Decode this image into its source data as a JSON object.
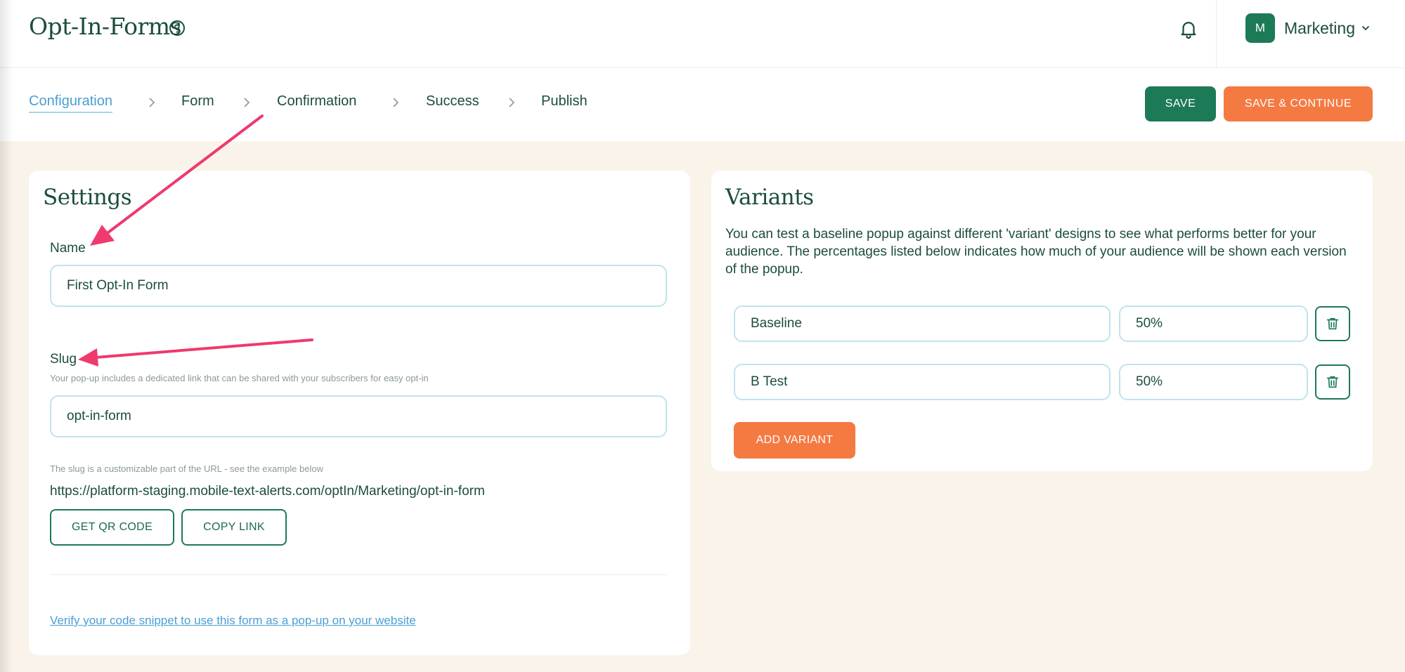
{
  "app": {
    "title": "Opt-In-Forms"
  },
  "header": {
    "account": {
      "initial": "M",
      "name": "Marketing"
    }
  },
  "steps": [
    {
      "label": "Configuration"
    },
    {
      "label": "Form"
    },
    {
      "label": "Confirmation"
    },
    {
      "label": "Success"
    },
    {
      "label": "Publish"
    }
  ],
  "actions": {
    "save_label": "SAVE",
    "save_continue_label": "SAVE & CONTINUE"
  },
  "settings": {
    "title": "Settings",
    "name_label": "Name",
    "name_value": "First Opt-In Form",
    "slug_label": "Slug",
    "slug_helper": "Your pop-up includes a dedicated link that can be shared with your subscribers for easy opt-in",
    "slug_value": "opt-in-form",
    "url_helper": "The slug is a customizable part of the URL - see the example below",
    "url": "https://platform-staging.mobile-text-alerts.com/optIn/Marketing/opt-in-form",
    "qr_button": "GET QR CODE",
    "copy_button": "COPY LINK",
    "verify_link": "Verify your code snippet to use this form as a pop-up on your website"
  },
  "variants": {
    "title": "Variants",
    "description": "You can test a baseline popup against different 'variant' designs to see what performs better for your audience. The percentages listed below indicates how much of your audience will be shown each version of the popup.",
    "rows": [
      {
        "name": "Baseline",
        "percent": "50%"
      },
      {
        "name": "B Test",
        "percent": "50%"
      }
    ],
    "add_button": "ADD VARIANT"
  },
  "colors": {
    "primary_green": "#1d7a56",
    "accent_orange": "#f47a42",
    "link_blue": "#4a9fd4",
    "annotation_pink": "#ee3a6e",
    "page_background": "#f9f3ea"
  },
  "icons": [
    "help-icon",
    "bell-icon",
    "chevron-down-icon",
    "chevron-right-icon",
    "trash-icon",
    "annotation-arrow"
  ]
}
